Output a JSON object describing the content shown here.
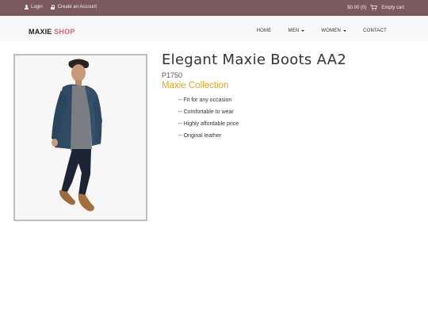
{
  "topbar": {
    "login_label": "Login",
    "create_account_label": "Create an Account",
    "cart_total": "$0.00 (0)",
    "cart_status": "Empty cart"
  },
  "navbar": {
    "brand_part1": "MAXIE",
    "brand_part2": "SHOP",
    "items": [
      {
        "label": "HOME",
        "dropdown": false
      },
      {
        "label": "MEN",
        "dropdown": true
      },
      {
        "label": "WOMEN",
        "dropdown": true
      },
      {
        "label": "CONTACT",
        "dropdown": false
      }
    ]
  },
  "product": {
    "title": "Elegant Maxie Boots AA2",
    "price": "P1750",
    "collection": "Maxie Collection",
    "features": [
      "-- Fit for any occasion",
      "-- Comfortable to wear",
      "-- Highly affordable price",
      "-- Original leather"
    ],
    "image_description_icon": "product-photo"
  },
  "colors": {
    "topbar_bg": "#7b5a5e",
    "brand_accent": "#e5606c",
    "collection_color": "#e7a51a"
  }
}
